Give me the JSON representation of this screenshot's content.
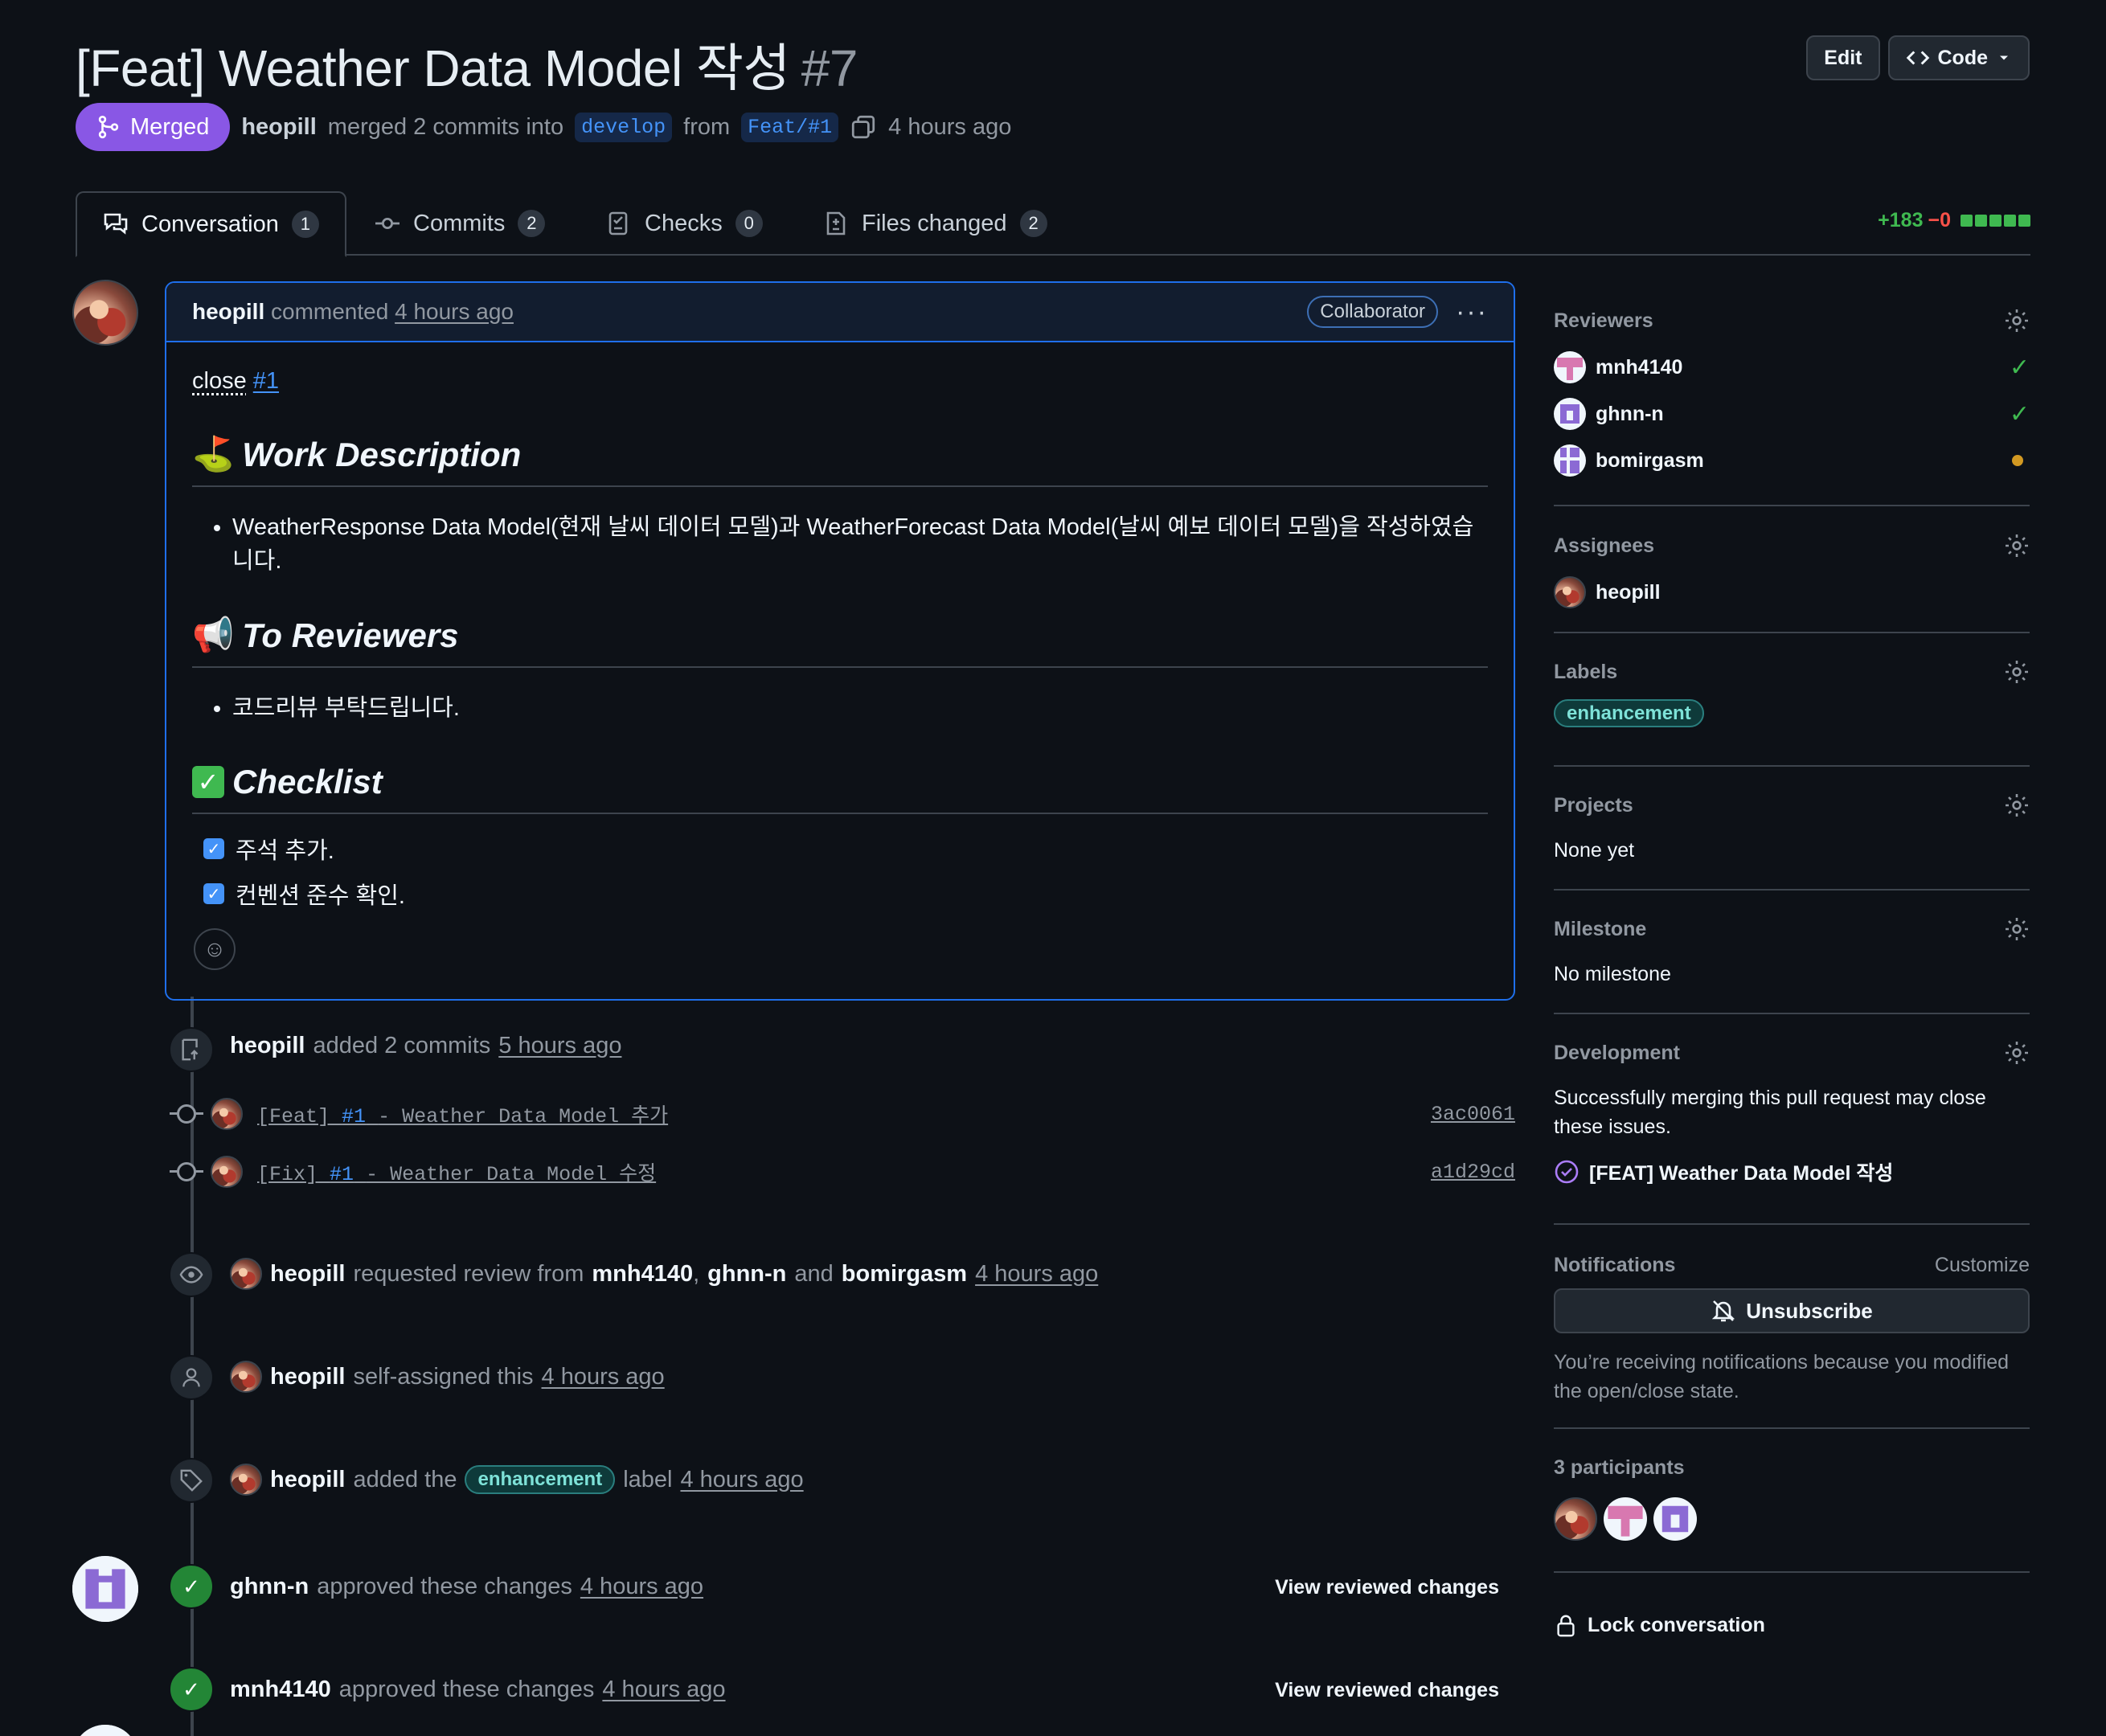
{
  "header": {
    "title": "[Feat] Weather Data Model 작성",
    "number": "#7",
    "edit_label": "Edit",
    "code_label": "Code",
    "state": "Merged",
    "author": "heopill",
    "merge_text": "merged 2 commits into",
    "base_branch": "develop",
    "from_text": "from",
    "head_branch": "Feat/#1",
    "time": "4 hours ago"
  },
  "tabs": [
    {
      "label": "Conversation",
      "count": "1"
    },
    {
      "label": "Commits",
      "count": "2"
    },
    {
      "label": "Checks",
      "count": "0"
    },
    {
      "label": "Files changed",
      "count": "2"
    }
  ],
  "diffstat": {
    "additions": "+183",
    "deletions": "−0"
  },
  "comment": {
    "author": "heopill",
    "action": "commented",
    "time": "4 hours ago",
    "role": "Collaborator",
    "close_text": "close",
    "close_ref": "#1",
    "h_work": "Work Description",
    "work_item": "WeatherResponse Data Model(현재 날씨 데이터 모델)과 WeatherForecast Data Model(날씨 예보 데이터 모델)을 작성하였습니다.",
    "h_reviewers": "To Reviewers",
    "reviewers_item": "코드리뷰 부탁드립니다.",
    "h_checklist": "Checklist",
    "checklist": [
      "주석 추가.",
      "컨벤션 준수 확인."
    ]
  },
  "events": {
    "commits": {
      "author": "heopill",
      "text": "added 2 commits",
      "time": "5 hours ago",
      "list": [
        {
          "prefix": "[Feat]",
          "ref": "#1",
          "msg": "- Weather Data Model 추가",
          "sha": "3ac0061"
        },
        {
          "prefix": "[Fix]",
          "ref": "#1",
          "msg": "- Weather Data Model 수정",
          "sha": "a1d29cd"
        }
      ]
    },
    "review_request": {
      "author": "heopill",
      "text": "requested review from",
      "r1": "mnh4140",
      "sep": ",",
      "r2": "ghnn-n",
      "and": "and",
      "r3": "bomirgasm",
      "time": "4 hours ago"
    },
    "self_assign": {
      "author": "heopill",
      "text": "self-assigned this",
      "time": "4 hours ago"
    },
    "label": {
      "author": "heopill",
      "text1": "added the",
      "label": "enhancement",
      "text2": "label",
      "time": "4 hours ago"
    },
    "approve1": {
      "author": "ghnn-n",
      "text": "approved these changes",
      "time": "4 hours ago",
      "action": "View reviewed changes"
    },
    "approve2": {
      "author": "mnh4140",
      "text": "approved these changes",
      "time": "4 hours ago",
      "action": "View reviewed changes"
    }
  },
  "sidebar": {
    "reviewers_h": "Reviewers",
    "reviewers": [
      {
        "name": "mnh4140",
        "status": "approved"
      },
      {
        "name": "ghnn-n",
        "status": "approved"
      },
      {
        "name": "bomirgasm",
        "status": "pending"
      }
    ],
    "assignees_h": "Assignees",
    "assignee": "heopill",
    "labels_h": "Labels",
    "label": "enhancement",
    "projects_h": "Projects",
    "projects_val": "None yet",
    "milestone_h": "Milestone",
    "milestone_val": "No milestone",
    "development_h": "Development",
    "development_txt": "Successfully merging this pull request may close these issues.",
    "linked_issue": "[FEAT] Weather Data Model 작성",
    "notifications_h": "Notifications",
    "customize": "Customize",
    "unsubscribe": "Unsubscribe",
    "notif_reason": "You’re receiving notifications because you modified the open/close state.",
    "participants_h": "3 participants",
    "lock": "Lock conversation"
  },
  "colors": {
    "merged": "#8957e5",
    "accent": "#4493f8",
    "success": "#3fb950",
    "pending": "#d29922"
  }
}
